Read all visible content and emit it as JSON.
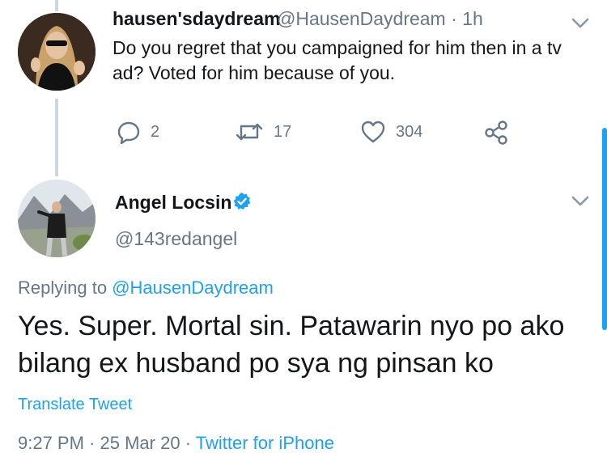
{
  "tweet1": {
    "display_name": "hausen'sdaydream",
    "handle": "@HausenDaydream",
    "time": "· 1h",
    "text": "Do you regret that you campaigned for him then in a tv ad? Voted for him because of you.",
    "reply_count": "2",
    "retweet_count": "17",
    "like_count": "304"
  },
  "tweet2": {
    "display_name": "Angel Locsin",
    "handle": "@143redangel",
    "replying_prefix": "Replying to",
    "replying_to": "@HausenDaydream",
    "text": "Yes. Super. Mortal sin. Patawarin nyo po ako bilang ex husband po sya ng pinsan ko",
    "translate_label": "Translate Tweet",
    "time": "9:27 PM",
    "date": "25 Mar 20",
    "source": "Twitter for iPhone"
  },
  "colors": {
    "accent": "#1da1f2",
    "muted": "#657786",
    "text": "#14171a"
  },
  "icons": [
    "chevron-down-icon",
    "reply-icon",
    "retweet-icon",
    "like-icon",
    "share-icon",
    "verified-badge-icon"
  ]
}
